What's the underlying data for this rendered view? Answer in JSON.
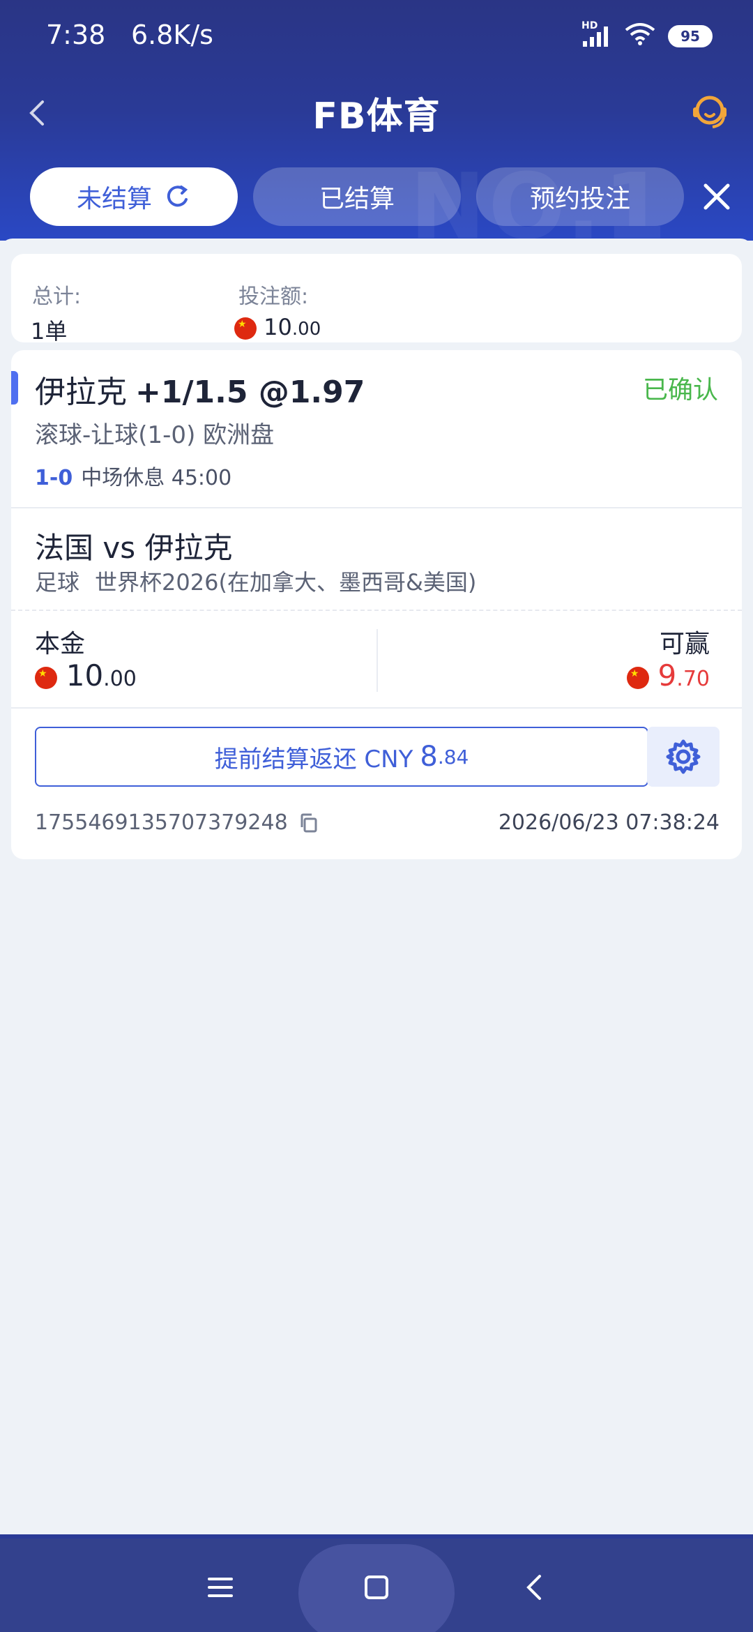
{
  "status_bar": {
    "time": "7:38",
    "network_speed": "6.8K/s",
    "signal_badge": "HD",
    "battery": "95"
  },
  "header": {
    "title": "FB体育"
  },
  "tabs": [
    {
      "label": "未结算",
      "active": true
    },
    {
      "label": "已结算",
      "active": false
    },
    {
      "label": "预约投注",
      "active": false
    }
  ],
  "summary": {
    "total_label": "总计:",
    "total_value": "1单",
    "stake_label": "投注额:",
    "stake_int": "10",
    "stake_dec": ".00"
  },
  "bet": {
    "selection_team": "伊拉克",
    "selection_odds": "+1/1.5 @1.97",
    "status": "已确认",
    "market": "滚球-让球(1-0) 欧洲盘",
    "live_score": "1-0",
    "live_status": "中场休息 45:00",
    "match": "法国 vs 伊拉克",
    "sport": "足球",
    "league": "世界杯2026(在加拿大、墨西哥&美国)",
    "stake_label": "本金",
    "stake_int": "10",
    "stake_dec": ".00",
    "win_label": "可赢",
    "win_int": "9",
    "win_dec": ".70",
    "cashout_label": "提前结算返还 CNY",
    "cashout_int": "8",
    "cashout_dec": ".84",
    "order_id": "1755469135707379248",
    "order_time": "2026/06/23 07:38:24"
  },
  "colors": {
    "header_top": "#2a3585",
    "header_bottom": "#2a48c4",
    "accent": "#3f5fd8",
    "confirmed": "#49b74c",
    "win": "#e63b3b",
    "support_icon": "#f2a63a"
  }
}
